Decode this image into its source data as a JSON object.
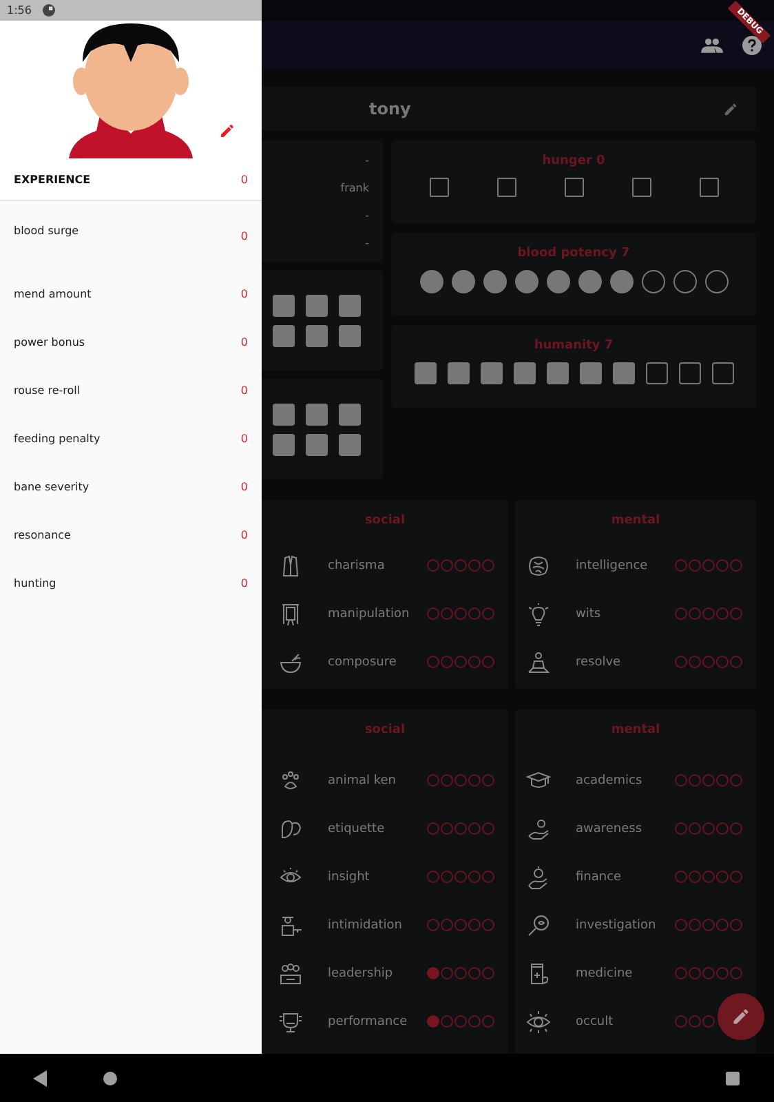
{
  "status_bar": {
    "time": "1:56"
  },
  "drawer": {
    "experience": {
      "label": "EXPERIENCE",
      "value": "0"
    },
    "items": [
      {
        "label": "blood surge",
        "value": "0"
      },
      {
        "label": "mend amount",
        "value": "0"
      },
      {
        "label": "power bonus",
        "value": "0"
      },
      {
        "label": "rouse re-roll",
        "value": "0"
      },
      {
        "label": "feeding penalty",
        "value": "0"
      },
      {
        "label": "bane severity",
        "value": "0"
      },
      {
        "label": "resonance",
        "value": "0"
      },
      {
        "label": "hunting",
        "value": "0"
      }
    ]
  },
  "debug_banner": "DEBUG",
  "character": {
    "name": "tony",
    "info": [
      "-",
      "frank",
      "-",
      "-"
    ]
  },
  "box_grids": [
    {
      "dots": [
        true,
        true,
        true,
        true,
        true,
        true
      ]
    },
    {
      "dots": [
        true,
        true,
        true,
        true,
        true,
        true
      ]
    }
  ],
  "trackers": [
    {
      "title": "hunger 0",
      "kind": "square",
      "dots": [
        false,
        false,
        false,
        false,
        false
      ]
    },
    {
      "title": "blood potency 7",
      "kind": "circle",
      "dots": [
        true,
        true,
        true,
        true,
        true,
        true,
        true,
        false,
        false,
        false
      ]
    },
    {
      "title": "humanity 7",
      "kind": "box",
      "dots": [
        true,
        true,
        true,
        true,
        true,
        true,
        true,
        false,
        false,
        false
      ]
    }
  ],
  "attributes": [
    {
      "title": "social",
      "traits": [
        {
          "name": "charisma",
          "dots": [
            false,
            false,
            false,
            false,
            false
          ]
        },
        {
          "name": "manipulation",
          "dots": [
            false,
            false,
            false,
            false,
            false
          ]
        },
        {
          "name": "composure",
          "dots": [
            false,
            false,
            false,
            false,
            false
          ]
        }
      ]
    },
    {
      "title": "mental",
      "traits": [
        {
          "name": "intelligence",
          "dots": [
            false,
            false,
            false,
            false,
            false
          ]
        },
        {
          "name": "wits",
          "dots": [
            false,
            false,
            false,
            false,
            false
          ]
        },
        {
          "name": "resolve",
          "dots": [
            false,
            false,
            false,
            false,
            false
          ]
        }
      ]
    }
  ],
  "skills": [
    {
      "title": "social",
      "traits": [
        {
          "name": "animal ken",
          "dots": [
            false,
            false,
            false,
            false,
            false
          ]
        },
        {
          "name": "etiquette",
          "dots": [
            false,
            false,
            false,
            false,
            false
          ]
        },
        {
          "name": "insight",
          "dots": [
            false,
            false,
            false,
            false,
            false
          ]
        },
        {
          "name": "intimidation",
          "dots": [
            false,
            false,
            false,
            false,
            false
          ]
        },
        {
          "name": "leadership",
          "dots": [
            true,
            false,
            false,
            false,
            false
          ]
        },
        {
          "name": "performance",
          "dots": [
            true,
            false,
            false,
            false,
            false
          ]
        }
      ]
    },
    {
      "title": "mental",
      "traits": [
        {
          "name": "academics",
          "dots": [
            false,
            false,
            false,
            false,
            false
          ]
        },
        {
          "name": "awareness",
          "dots": [
            false,
            false,
            false,
            false,
            false
          ]
        },
        {
          "name": "finance",
          "dots": [
            false,
            false,
            false,
            false,
            false
          ]
        },
        {
          "name": "investigation",
          "dots": [
            false,
            false,
            false,
            false,
            false
          ]
        },
        {
          "name": "medicine",
          "dots": [
            false,
            false,
            false,
            false,
            false
          ]
        },
        {
          "name": "occult",
          "dots": [
            false,
            false,
            false
          ]
        }
      ]
    }
  ]
}
